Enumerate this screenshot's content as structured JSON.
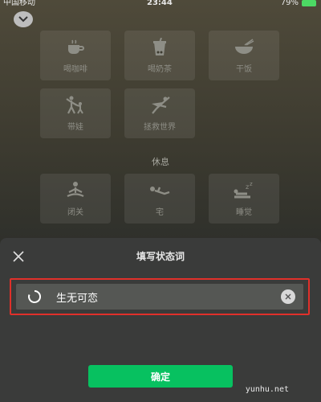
{
  "status_bar": {
    "carrier": "中国移动",
    "time": "23:44",
    "battery": "79%"
  },
  "grid": {
    "row1": [
      {
        "label": "喝咖啡",
        "icon": "coffee-icon"
      },
      {
        "label": "喝奶茶",
        "icon": "milk-tea-icon"
      },
      {
        "label": "干饭",
        "icon": "rice-bowl-icon"
      }
    ],
    "row2": [
      {
        "label": "带娃",
        "icon": "parent-child-icon"
      },
      {
        "label": "拯救世界",
        "icon": "superhero-icon"
      }
    ],
    "section_title": "休息",
    "row3": [
      {
        "label": "闭关",
        "icon": "meditation-icon"
      },
      {
        "label": "宅",
        "icon": "lying-down-icon"
      },
      {
        "label": "睡觉",
        "icon": "sleep-icon"
      }
    ]
  },
  "sheet": {
    "title": "填写状态词",
    "input_value": "生无可恋",
    "confirm_label": "确定"
  },
  "watermark": "yunhu.net",
  "colors": {
    "accent": "#07c160",
    "highlight_border": "#e0302a"
  }
}
